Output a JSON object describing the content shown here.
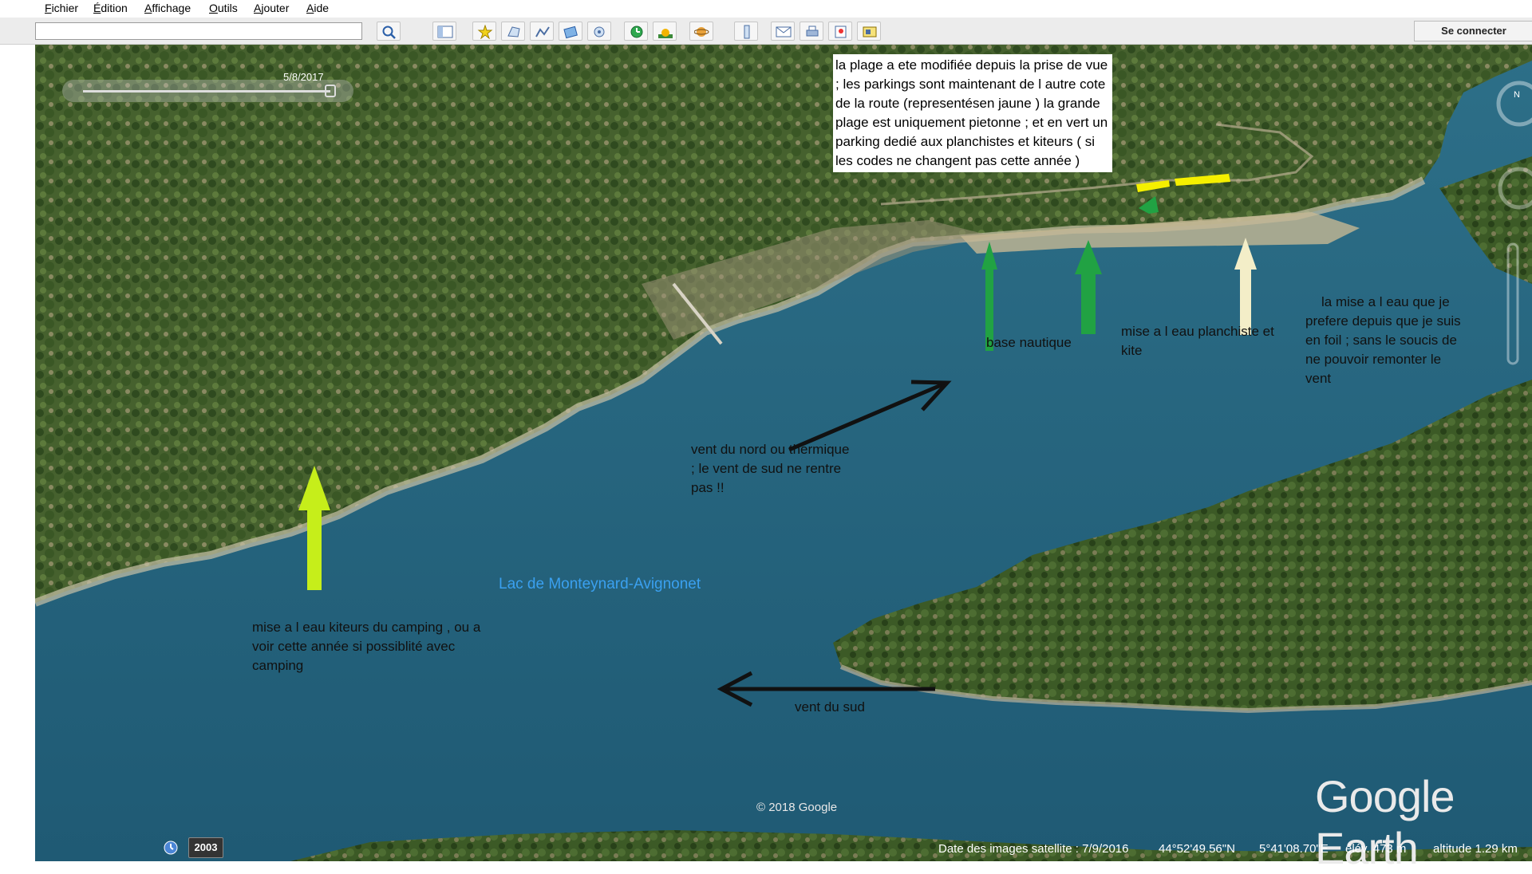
{
  "menu": [
    "Fichier",
    "Édition",
    "Affichage",
    "Outils",
    "Ajouter",
    "Aide"
  ],
  "toolbar": {
    "search_value": "",
    "signin_label": "Se connecter"
  },
  "timeline": {
    "date": "5/8/2017",
    "historical_year": "2003"
  },
  "annotations": {
    "info_box": "la plage a ete modifiée depuis la prise de vue ; les parkings sont maintenant de l autre cote de la route (representésen jaune ) la grande plage est uniquement pietonne ; et en vert un parking dedié aux planchistes et kiteurs ( si les codes ne changent pas cette année )",
    "base_nautique": "base nautique",
    "mise_planchiste": "mise a l eau planchiste et kite",
    "mise_foil": "la mise a l eau que je prefere depuis que je suis en foil ; sans le soucis de ne pouvoir remonter le vent",
    "vent_nord": "vent du nord ou thermique ; le vent de sud ne rentre pas !!",
    "mise_camping": "mise a l eau kiteurs du camping , ou a voir cette année si possiblité avec camping",
    "vent_sud": "vent du sud"
  },
  "map": {
    "lake_label": "Lac de Monteynard-Avignonet",
    "copyright": "© 2018 Google",
    "logo": "Google Earth"
  },
  "status": {
    "image_date": "Date des images satellite : 7/9/2016",
    "lat": "44°52'49.56\"N",
    "lon": "5°41'08.70\"E",
    "elev": "élév.  473 m",
    "altitude": "altitude   1.29 km"
  },
  "colors": {
    "water": "#2f6f86",
    "forest": "#3f5a2a",
    "parking_yellow": "#f5ef00",
    "arrow_green": "#21a243",
    "arrow_lime": "#c6ee1a",
    "arrow_cream": "#f3eec8"
  },
  "icons": [
    "search-icon",
    "sidebar-icon",
    "placemark-icon",
    "polygon-icon",
    "path-icon",
    "overlay-icon",
    "tour-icon",
    "history-icon",
    "sunlight-icon",
    "planet-icon",
    "ruler-icon",
    "email-icon",
    "print-icon",
    "maps-icon",
    "save-image-icon"
  ]
}
